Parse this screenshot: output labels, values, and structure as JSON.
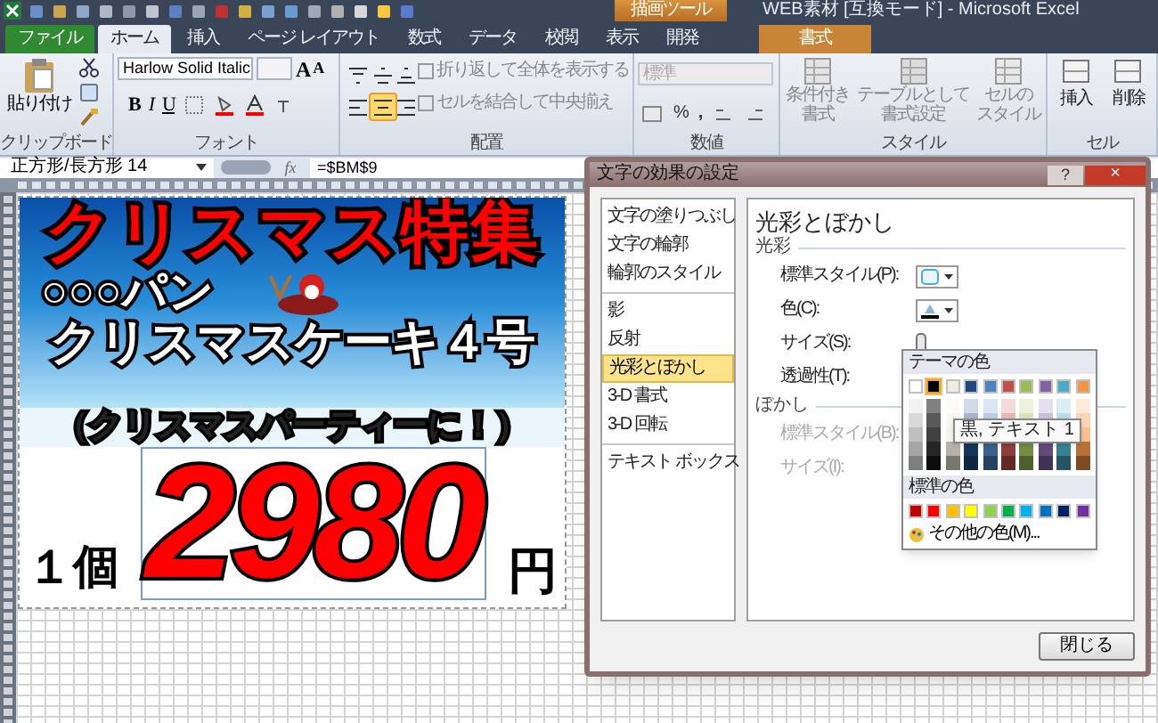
{
  "title_bar": {
    "contextual_tab": "描画ツール",
    "title": "WEB素材 [互換モード] - Microsoft Excel"
  },
  "tabs": [
    {
      "label": "ファイル",
      "kind": "file",
      "selected": false
    },
    {
      "label": "ホーム",
      "kind": "normal",
      "selected": true
    },
    {
      "label": "挿入",
      "kind": "normal",
      "selected": false
    },
    {
      "label": "ページ レイアウト",
      "kind": "normal",
      "selected": false
    },
    {
      "label": "数式",
      "kind": "normal",
      "selected": false
    },
    {
      "label": "データ",
      "kind": "normal",
      "selected": false
    },
    {
      "label": "校閲",
      "kind": "normal",
      "selected": false
    },
    {
      "label": "表示",
      "kind": "normal",
      "selected": false
    },
    {
      "label": "開発",
      "kind": "normal",
      "selected": false
    },
    {
      "label": "書式",
      "kind": "contextual",
      "selected": false
    }
  ],
  "ribbon": {
    "clipboard": {
      "paste": "貼り付け",
      "label": "クリップボード"
    },
    "font": {
      "name": "Harlow Solid Italic",
      "grow": "A",
      "shrink": "A",
      "bold": "B",
      "italic": "I",
      "underline": "U",
      "label": "フォント"
    },
    "alignment": {
      "buttons": [
        {
          "kind": "top",
          "selected": false
        },
        {
          "kind": "middle",
          "selected": false
        },
        {
          "kind": "bottom",
          "selected": false
        },
        {
          "kind": "left",
          "selected": false
        },
        {
          "kind": "center",
          "selected": true
        },
        {
          "kind": "right",
          "selected": false
        }
      ],
      "wrap": "折り返して全体を表示する",
      "merge": "セルを結合して中央揃え",
      "label": "配置"
    },
    "number": {
      "format": "標準",
      "percent": "%",
      "comma": ",",
      "label": "数値"
    },
    "styles": {
      "conditional": [
        "条件付き",
        "書式"
      ],
      "table": [
        "テーブルとして",
        "書式設定"
      ],
      "cell": [
        "セルの",
        "スタイル"
      ],
      "label": "スタイル"
    },
    "cells": {
      "insert": "挿入",
      "delete": "削除",
      "label": "セル"
    }
  },
  "formula_bar": {
    "name_box": "正方形/長方形 14",
    "fx": "fx",
    "formula": "=$BM$9"
  },
  "poster": {
    "heading": "クリスマス特集",
    "brand": "○○○パン",
    "product": "クリスマスケーキ４号",
    "tagline": "（クリスマスパーティーに！）",
    "quantity": "１個",
    "price": "2980",
    "currency": "円"
  },
  "dialog": {
    "title": "文字の効果の設定",
    "help": "?",
    "close": "×",
    "categories": [
      {
        "items": [
          {
            "label": "文字の塗りつぶし",
            "selected": false
          },
          {
            "label": "文字の輪郭",
            "selected": false
          },
          {
            "label": "輪郭のスタイル",
            "selected": false
          }
        ]
      },
      {
        "items": [
          {
            "label": "影",
            "selected": false
          },
          {
            "label": "反射",
            "selected": false
          },
          {
            "label": "光彩とぼかし",
            "selected": true
          },
          {
            "label": "3-D 書式",
            "selected": false
          },
          {
            "label": "3-D 回転",
            "selected": false
          }
        ]
      },
      {
        "items": [
          {
            "label": "テキスト ボックス",
            "selected": false
          }
        ]
      }
    ],
    "heading": "光彩とぼかし",
    "glow": {
      "title": "光彩",
      "preset_label": "標準スタイル(P):",
      "color_label": "色(C):",
      "size_label": "サイズ(S):",
      "transparency_label": "透過性(T):"
    },
    "soft_edges": {
      "title": "ぼかし",
      "disabled": true,
      "preset_label": "標準スタイル(B):",
      "size_label": "サイズ(I):"
    },
    "close_button": "閉じる",
    "color_menu": {
      "theme_title": "テーマの色",
      "theme_colors": [
        {
          "color": "#ffffff",
          "selected": false
        },
        {
          "color": "#000000",
          "selected": true
        },
        {
          "color": "#eeece1",
          "selected": false
        },
        {
          "color": "#1f497d",
          "selected": false
        },
        {
          "color": "#4f81bd",
          "selected": false
        },
        {
          "color": "#c0504d",
          "selected": false
        },
        {
          "color": "#9bbb59",
          "selected": false
        },
        {
          "color": "#8064a2",
          "selected": false
        },
        {
          "color": "#4bacc6",
          "selected": false
        },
        {
          "color": "#f79646",
          "selected": false
        }
      ],
      "tooltip": "黒, テキスト 1",
      "standard_title": "標準の色",
      "standard_colors": [
        {
          "color": "#c00000"
        },
        {
          "color": "#ff0000"
        },
        {
          "color": "#ffc000"
        },
        {
          "color": "#ffff00"
        },
        {
          "color": "#92d050"
        },
        {
          "color": "#00b050"
        },
        {
          "color": "#00b0f0"
        },
        {
          "color": "#0070c0"
        },
        {
          "color": "#002060"
        },
        {
          "color": "#7030a0"
        }
      ],
      "more": "その他の色(M)..."
    }
  }
}
